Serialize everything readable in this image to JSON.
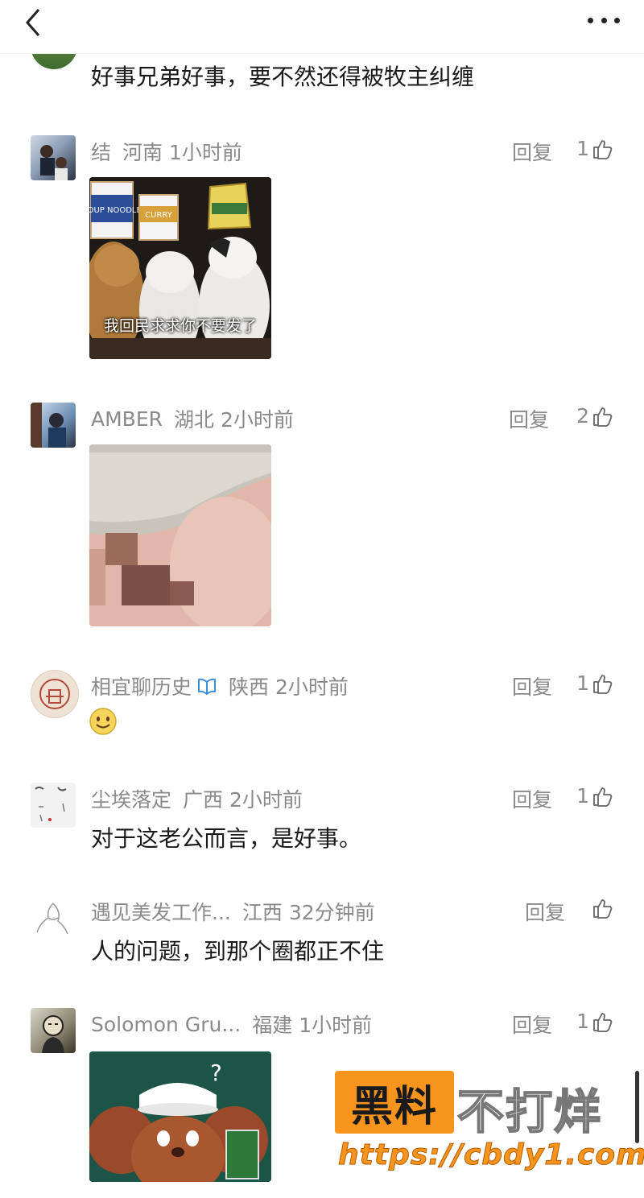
{
  "header": {
    "back_icon": "chevron-left-icon",
    "more_icon": "more-dots-icon"
  },
  "comments": [
    {
      "user": "",
      "location": "",
      "time": "",
      "text": "好事兄弟好事，要不然还得被牧主纠缠"
    },
    {
      "user": "结",
      "location": "河南",
      "time": "1小时前",
      "reply": "回复",
      "likes": "1",
      "image_caption": "我回民求求你不要发了",
      "image_label_1": "SOUP NOODLE",
      "image_label_2": "CURRY"
    },
    {
      "user": "AMBER",
      "location": "湖北",
      "time": "2小时前",
      "reply": "回复",
      "likes": "2"
    },
    {
      "user": "相宜聊历史",
      "location": "陕西",
      "time": "2小时前",
      "reply": "回复",
      "likes": "1",
      "text": "🙂",
      "badge_icon": "verified-badge-icon"
    },
    {
      "user": "尘埃落定",
      "location": "广西",
      "time": "2小时前",
      "reply": "回复",
      "likes": "1",
      "text": "对于这老公而言，是好事。"
    },
    {
      "user": "遇见美发工作...",
      "location": "江西",
      "time": "32分钟前",
      "reply": "回复",
      "likes": "",
      "text": "人的问题，到那个圈都正不住"
    },
    {
      "user": "Solomon Gru...",
      "location": "福建",
      "time": "1小时前",
      "reply": "回复",
      "likes": "1",
      "image_mark": "?"
    }
  ],
  "watermark": {
    "black_text": "黑料",
    "white_text": "不打烊",
    "url": "https://cbdy1.com"
  },
  "colors": {
    "meta_text": "#8a8a8a",
    "body_text": "#1a1a1a",
    "watermark_orange": "#f7941d"
  }
}
